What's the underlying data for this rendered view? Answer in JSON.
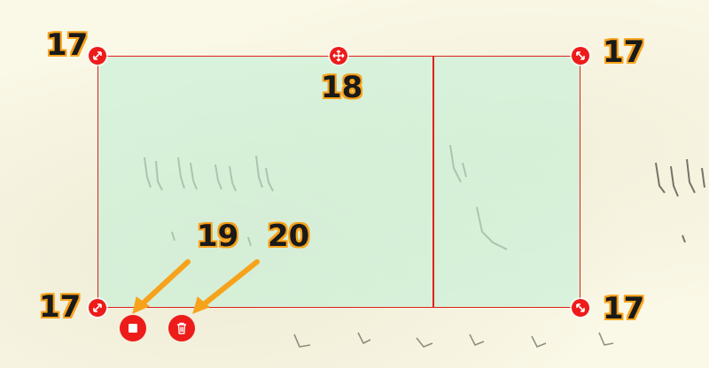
{
  "annotation_labels": {
    "corner_top_left": "17",
    "corner_top_right": "17",
    "corner_bottom_left": "17",
    "corner_bottom_right": "17",
    "move_handle": "18",
    "stop_button": "19",
    "delete_button": "20"
  },
  "colors": {
    "selection_border": "#e0201c",
    "selection_fill": "#c8f0d7",
    "handle": "#ee1b1b",
    "callout_outline": "#f7a21b",
    "arrow": "#f7a21b",
    "background": "#faf8e6"
  },
  "icons": {
    "corner_handle": "resize-diagonal-icon",
    "move_handle": "move-arrows-icon",
    "stop": "stop-square-icon",
    "delete": "trash-icon"
  }
}
